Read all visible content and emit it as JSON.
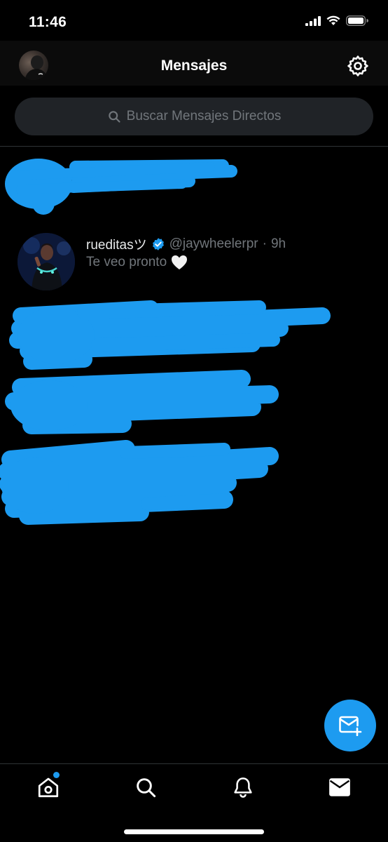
{
  "status_bar": {
    "time": "11:46"
  },
  "header": {
    "title": "Mensajes"
  },
  "search": {
    "placeholder": "Buscar Mensajes Directos"
  },
  "conversations": [
    {
      "display_name": "rueditasツ",
      "verified": true,
      "handle": "@jaywheelerpr",
      "separator": "·",
      "time": "9h",
      "last_message": "Te veo pronto",
      "emoji": "heart-icon"
    }
  ],
  "redacted_rows": 4,
  "colors": {
    "accent": "#1d9bf0",
    "background": "#000000",
    "search_bg": "#202327",
    "muted_text": "#71767b",
    "redaction": "#1d9bf0"
  },
  "nav": {
    "items": [
      "home-icon",
      "search-icon",
      "notifications-icon",
      "messages-icon"
    ],
    "active": "messages-icon"
  }
}
